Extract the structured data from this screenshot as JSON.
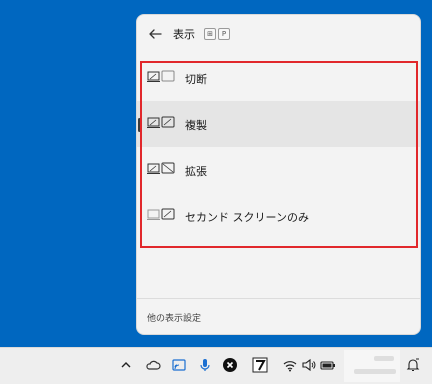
{
  "panel": {
    "title": "表示",
    "shortcut_keys": [
      "⊞",
      "P"
    ],
    "options": [
      {
        "label": "切断",
        "selected": false
      },
      {
        "label": "複製",
        "selected": true
      },
      {
        "label": "拡張",
        "selected": false
      },
      {
        "label": "セカンド スクリーンのみ",
        "selected": false
      }
    ],
    "footer_link": "他の表示設定"
  },
  "taskbar": {
    "tray_icons": [
      "chevron-up-icon",
      "cloud-icon",
      "cast-icon",
      "microphone-icon",
      "close-circle-icon",
      "app-icon"
    ],
    "status_icons": [
      "wifi-icon",
      "speaker-icon",
      "battery-icon",
      "notification-icon"
    ]
  },
  "colors": {
    "desktop": "#0067c0",
    "highlight": "#e1272b",
    "panel": "#f3f3f3"
  }
}
